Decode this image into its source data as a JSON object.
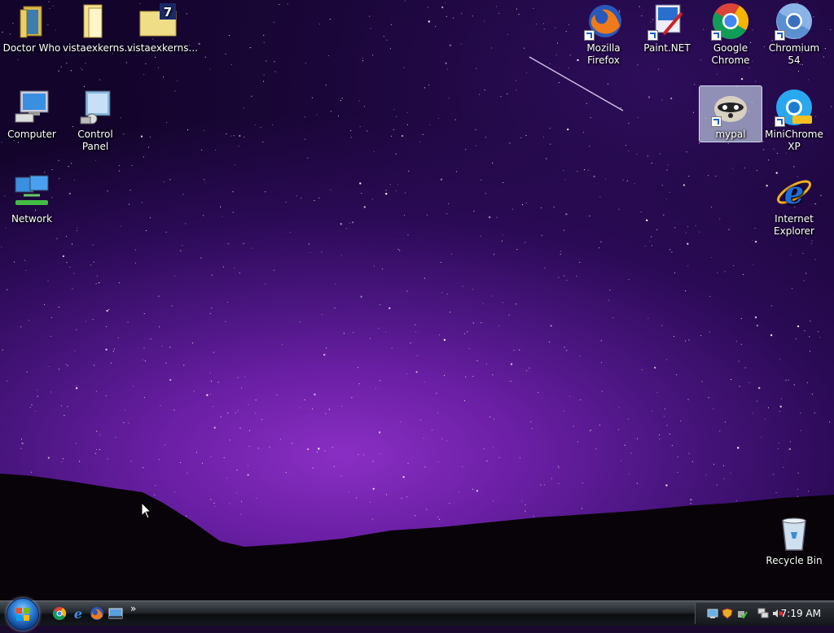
{
  "desktop": {
    "icons": [
      {
        "label": "Doctor Who",
        "icon": "folder-icon"
      },
      {
        "label": "vistaexkerns...",
        "icon": "folder-icon"
      },
      {
        "label": "vistaexkerns...",
        "icon": "7zip-archive-icon"
      },
      {
        "label": "Computer",
        "icon": "computer-icon"
      },
      {
        "label": "Control Panel",
        "icon": "control-panel-icon"
      },
      {
        "label": "Network",
        "icon": "network-icon"
      },
      {
        "label": "Mozilla Firefox",
        "icon": "firefox-icon"
      },
      {
        "label": "Paint.NET",
        "icon": "paintnet-icon"
      },
      {
        "label": "Google Chrome",
        "icon": "chrome-icon"
      },
      {
        "label": "Chromium 54",
        "icon": "chromium-icon"
      },
      {
        "label": "mypal",
        "icon": "mypal-icon"
      },
      {
        "label": "MiniChrome XP",
        "icon": "minichrome-icon"
      },
      {
        "label": "Internet Explorer",
        "icon": "ie-icon"
      },
      {
        "label": "Recycle Bin",
        "icon": "recycle-bin-icon"
      }
    ]
  },
  "taskbar": {
    "start_icon": "windows-start-icon",
    "quick_launch": [
      "chrome-icon",
      "ie-icon",
      "firefox-icon",
      "show-desktop-icon"
    ],
    "overflow": "»",
    "tray_icons": [
      "network-status-icon",
      "security-shield-icon",
      "safely-remove-icon",
      "network-connection-icon",
      "volume-muted-icon"
    ],
    "clock": "7:19 AM"
  }
}
